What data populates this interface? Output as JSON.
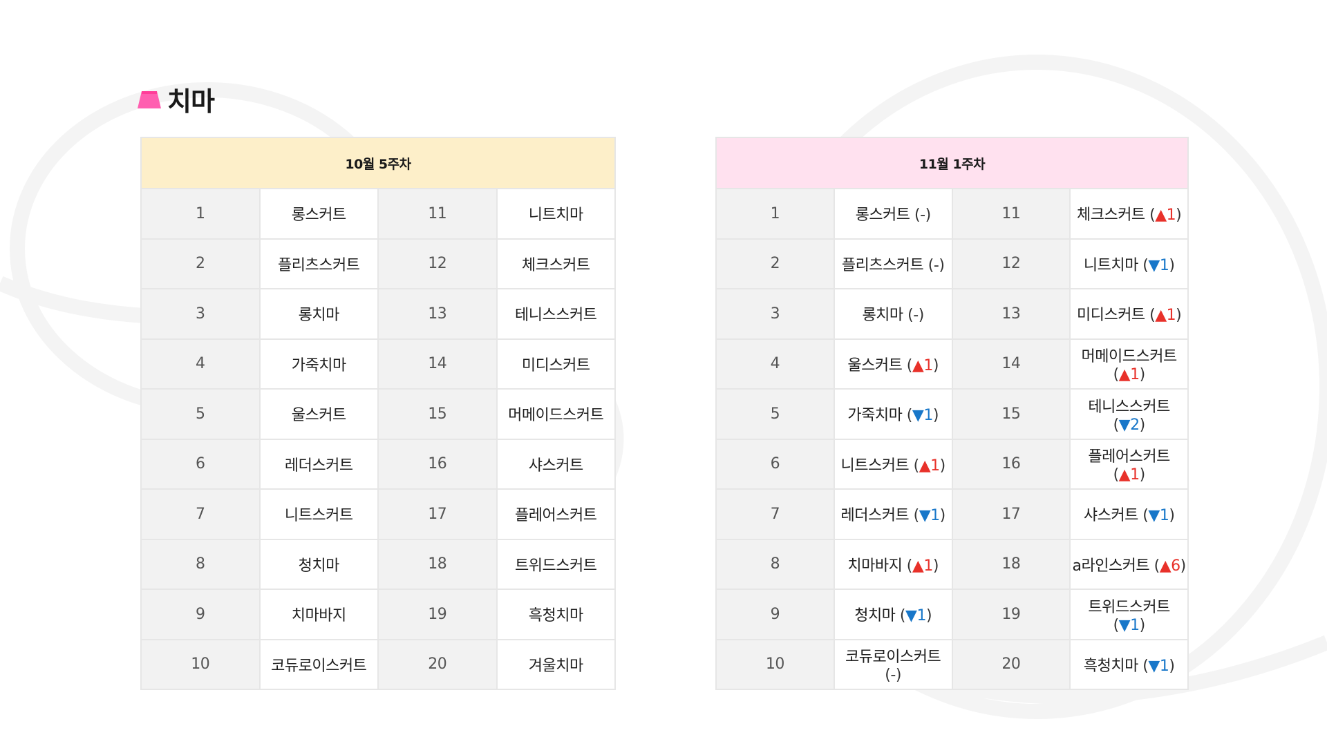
{
  "section": {
    "title": "치마",
    "icon": "skirt-icon",
    "icon_color": "#ff5fb0"
  },
  "tables": [
    {
      "id": "oct-week5",
      "header": "10월 5주차",
      "header_color": "#fdefc9",
      "rows": [
        {
          "left_rank": "1",
          "left_name": "롱스커트",
          "right_rank": "11",
          "right_name": "니트치마"
        },
        {
          "left_rank": "2",
          "left_name": "플리츠스커트",
          "right_rank": "12",
          "right_name": "체크스커트"
        },
        {
          "left_rank": "3",
          "left_name": "롱치마",
          "right_rank": "13",
          "right_name": "테니스스커트"
        },
        {
          "left_rank": "4",
          "left_name": "가죽치마",
          "right_rank": "14",
          "right_name": "미디스커트"
        },
        {
          "left_rank": "5",
          "left_name": "울스커트",
          "right_rank": "15",
          "right_name": "머메이드스커트"
        },
        {
          "left_rank": "6",
          "left_name": "레더스커트",
          "right_rank": "16",
          "right_name": "샤스커트"
        },
        {
          "left_rank": "7",
          "left_name": "니트스커트",
          "right_rank": "17",
          "right_name": "플레어스커트"
        },
        {
          "left_rank": "8",
          "left_name": "청치마",
          "right_rank": "18",
          "right_name": "트위드스커트"
        },
        {
          "left_rank": "9",
          "left_name": "치마바지",
          "right_rank": "19",
          "right_name": "흑청치마"
        },
        {
          "left_rank": "10",
          "left_name": "코듀로이스커트",
          "right_rank": "20",
          "right_name": "겨울치마"
        }
      ]
    },
    {
      "id": "nov-week1",
      "header": "11월 1주차",
      "header_color": "#ffe1ef",
      "rows": [
        {
          "left_rank": "1",
          "left_name": "롱스커트",
          "left_change": "-",
          "left_dir": "none",
          "right_rank": "11",
          "right_name": "체크스커트",
          "right_change": "1",
          "right_dir": "up"
        },
        {
          "left_rank": "2",
          "left_name": "플리츠스커트",
          "left_change": "-",
          "left_dir": "none",
          "right_rank": "12",
          "right_name": "니트치마",
          "right_change": "1",
          "right_dir": "down"
        },
        {
          "left_rank": "3",
          "left_name": "롱치마",
          "left_change": "-",
          "left_dir": "none",
          "right_rank": "13",
          "right_name": "미디스커트",
          "right_change": "1",
          "right_dir": "up"
        },
        {
          "left_rank": "4",
          "left_name": "울스커트",
          "left_change": "1",
          "left_dir": "up",
          "right_rank": "14",
          "right_name": "머메이드스커트",
          "right_change": "1",
          "right_dir": "up"
        },
        {
          "left_rank": "5",
          "left_name": "가죽치마",
          "left_change": "1",
          "left_dir": "down",
          "right_rank": "15",
          "right_name": "테니스스커트",
          "right_change": "2",
          "right_dir": "down"
        },
        {
          "left_rank": "6",
          "left_name": "니트스커트",
          "left_change": "1",
          "left_dir": "up",
          "right_rank": "16",
          "right_name": "플레어스커트",
          "right_change": "1",
          "right_dir": "up"
        },
        {
          "left_rank": "7",
          "left_name": "레더스커트",
          "left_change": "1",
          "left_dir": "down",
          "right_rank": "17",
          "right_name": "샤스커트",
          "right_change": "1",
          "right_dir": "down"
        },
        {
          "left_rank": "8",
          "left_name": "치마바지",
          "left_change": "1",
          "left_dir": "up",
          "right_rank": "18",
          "right_name": "a라인스커트",
          "right_change": "6",
          "right_dir": "up"
        },
        {
          "left_rank": "9",
          "left_name": "청치마",
          "left_change": "1",
          "left_dir": "down",
          "right_rank": "19",
          "right_name": "트위드스커트",
          "right_change": "1",
          "right_dir": "down"
        },
        {
          "left_rank": "10",
          "left_name": "코듀로이스커트",
          "left_change": "-",
          "left_dir": "none",
          "right_rank": "20",
          "right_name": "흑청치마",
          "right_change": "1",
          "right_dir": "down"
        }
      ]
    }
  ],
  "colors": {
    "up": "#e8312a",
    "down": "#1877c9",
    "rank_cell": "#f2f2f2",
    "border": "#e6e6e6"
  }
}
